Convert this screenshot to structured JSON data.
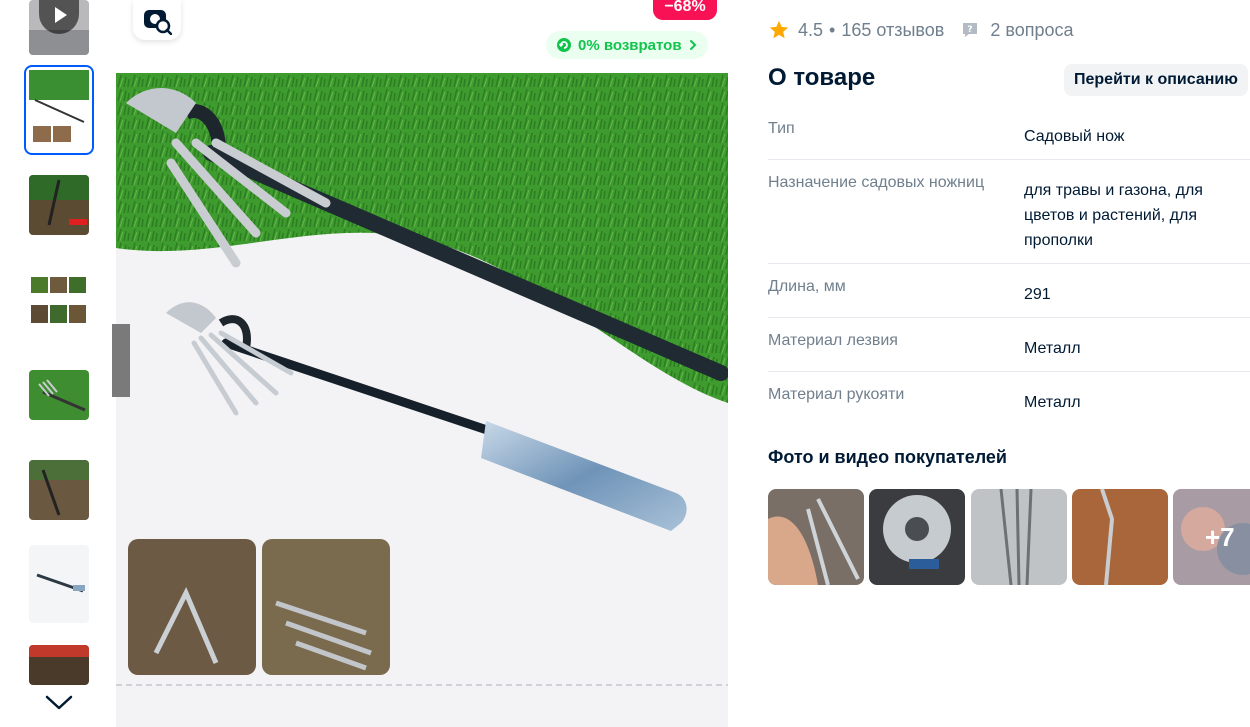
{
  "product_gallery": {
    "discount_badge": "−68%",
    "returns_badge": "0% возвратов",
    "thumbnail_count": 8
  },
  "rating": {
    "score": "4.5",
    "separator": "•",
    "reviews": "165 отзывов",
    "questions": "2 вопроса"
  },
  "about": {
    "title": "О товаре",
    "go_to_description": "Перейти к описанию",
    "specs": [
      {
        "key": "Тип",
        "value": "Садовый нож"
      },
      {
        "key": "Назначение садовых ножниц",
        "value": "для травы и газона, для цветов и растений, для прополки"
      },
      {
        "key": "Длина, мм",
        "value": "291"
      },
      {
        "key": "Материал лезвия",
        "value": "Металл"
      },
      {
        "key": "Материал рукояти",
        "value": "Металл"
      }
    ]
  },
  "ugc": {
    "title": "Фото и видео покупателей",
    "more_count": "+7"
  },
  "colors": {
    "accent": "#005bff",
    "discount": "#f91155",
    "returns_green": "#10c44c",
    "rating_star": "#ffa800",
    "muted_text": "#707f8d",
    "primary_text": "#001a34"
  }
}
